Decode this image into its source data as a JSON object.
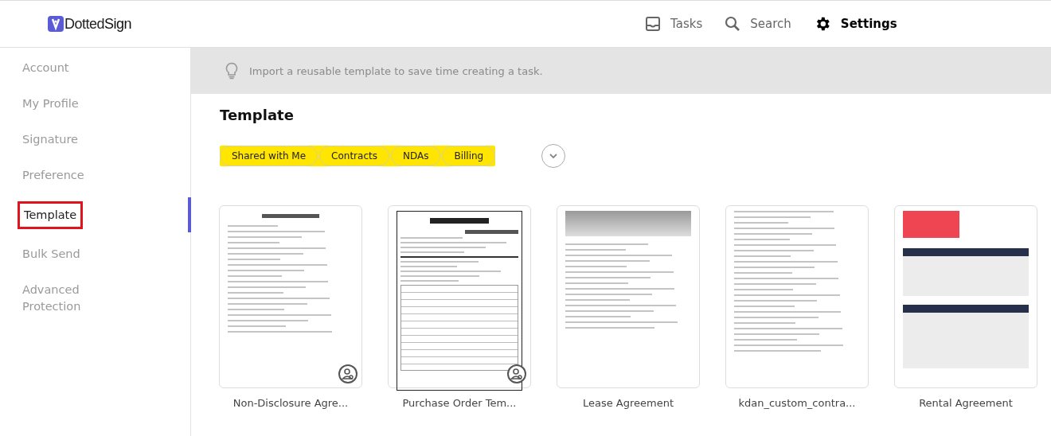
{
  "header": {
    "logo": {
      "prefix": "Dotted",
      "suffix": "Sign"
    },
    "nav": [
      {
        "label": "Tasks",
        "kind": "tasks",
        "selected": false
      },
      {
        "label": "Search",
        "kind": "search",
        "selected": false
      },
      {
        "label": "Settings",
        "kind": "settings",
        "selected": true
      }
    ]
  },
  "sidebar": {
    "items": [
      {
        "label": "Account",
        "selected": false
      },
      {
        "label": "My Profile",
        "selected": false
      },
      {
        "label": "Signature",
        "selected": false
      },
      {
        "label": "Preference",
        "selected": false
      },
      {
        "label": "Template",
        "selected": true
      },
      {
        "label": "Bulk Send",
        "selected": false
      },
      {
        "label": "Advanced Protection",
        "selected": false
      }
    ]
  },
  "banner": {
    "text": "Import a reusable template to save time creating a task."
  },
  "page_title": "Template",
  "filters": [
    {
      "label": "Shared with Me"
    },
    {
      "label": "Contracts"
    },
    {
      "label": "NDAs"
    },
    {
      "label": "Billing"
    }
  ],
  "templates": [
    {
      "name": "Non-Disclosure Agre...",
      "kind": "nda",
      "shared": true
    },
    {
      "name": "Purchase Order Tem...",
      "kind": "purchase",
      "shared": true
    },
    {
      "name": "Lease Agreement",
      "kind": "lease",
      "shared": false
    },
    {
      "name": "kdan_custom_contra...",
      "kind": "contract",
      "shared": false
    },
    {
      "name": "Rental Agreement",
      "kind": "rental",
      "shared": false
    }
  ]
}
